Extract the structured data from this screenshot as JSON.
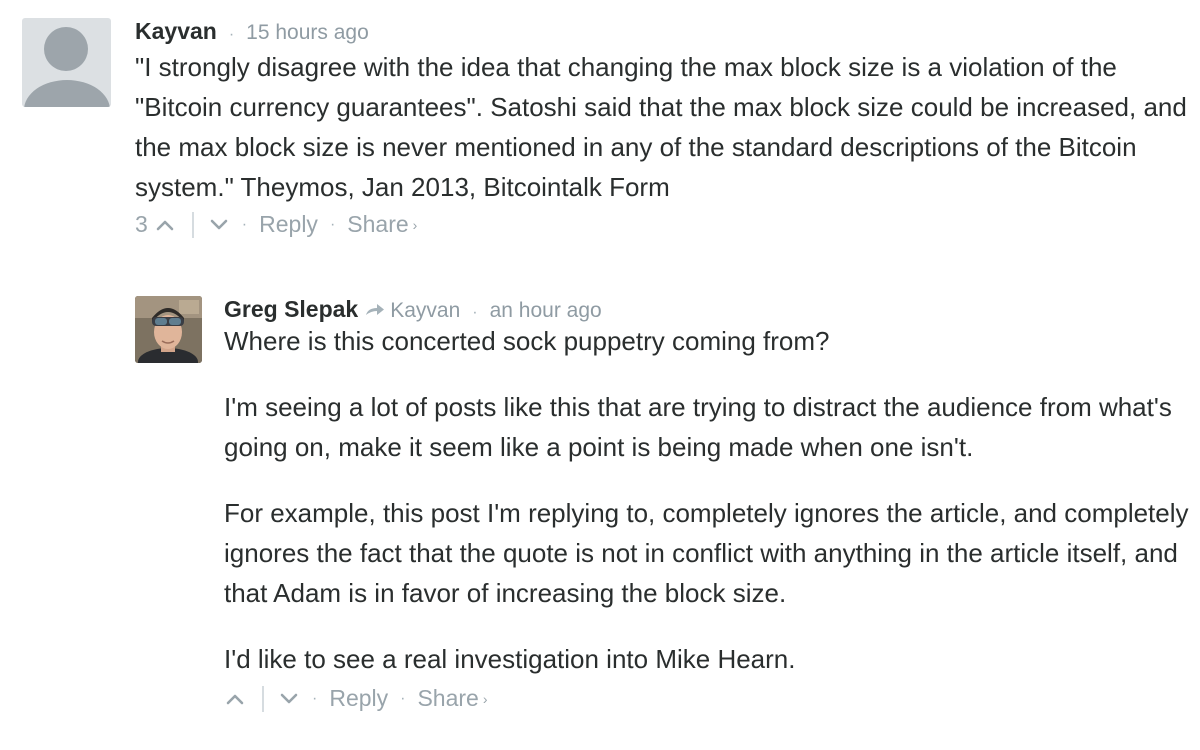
{
  "comments": [
    {
      "author": "Kayvan",
      "time": "15 hours ago",
      "text": "\"I strongly disagree with the idea that changing the max block size is a violation of the \"Bitcoin currency guarantees\". Satoshi said that the max block size could be increased, and the max block size is never mentioned in any of the standard descriptions of the Bitcoin system.\" Theymos, Jan 2013, Bitcointalk Form",
      "votes": "3",
      "reply_label": "Reply",
      "share_label": "Share",
      "share_chevron": "›",
      "separator": "·"
    },
    {
      "author": "Greg Slepak",
      "in_reply_to": "Kayvan",
      "time": "an hour ago",
      "paragraphs": [
        "Where is this concerted sock puppetry coming from?",
        "I'm seeing a lot of posts like this that are trying to distract the audience from what's going on, make it seem like a point is being made when one isn't.",
        "For example, this post I'm replying to, completely ignores the article, and completely ignores the fact that the quote is not in conflict with anything in the article itself, and that Adam is in favor of increasing the block size.",
        "I'd like to see a real investigation into Mike Hearn."
      ],
      "reply_label": "Reply",
      "share_label": "Share",
      "share_chevron": "›",
      "separator": "·"
    }
  ],
  "icons": {
    "upvote": "chevron-up-icon",
    "downvote": "chevron-down-icon",
    "reply_arrow": "reply-arrow-icon",
    "default_avatar": "default-avatar-icon"
  },
  "colors": {
    "text": "#2a2e2e",
    "muted": "#8f9ba3",
    "avatar_bg": "#dce0e3",
    "avatar_fg": "#9da5ab"
  }
}
